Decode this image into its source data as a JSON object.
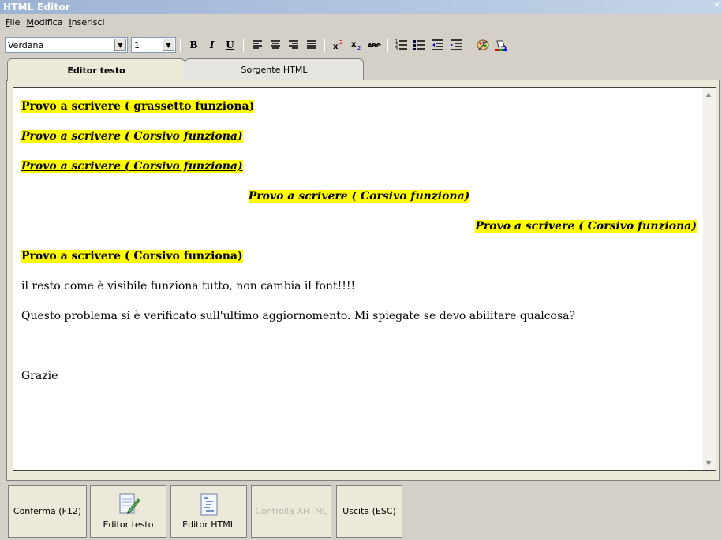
{
  "window": {
    "title": "HTML Editor"
  },
  "menu": {
    "items": [
      {
        "label": "File",
        "key": "F",
        "rest": "ile"
      },
      {
        "label": "Modifica",
        "key": "M",
        "rest": "odifica"
      },
      {
        "label": "Inserisci",
        "key": "I",
        "rest": "nserisci"
      }
    ]
  },
  "toolbar": {
    "font_value": "Verdana",
    "size_value": "1",
    "bold": "B",
    "italic": "I",
    "underline": "U"
  },
  "tabs": [
    {
      "label": "Editor testo",
      "active": true
    },
    {
      "label": "Sorgente HTML",
      "active": false
    }
  ],
  "editor": {
    "paragraphs": [
      {
        "text": "Provo a scrivere ( grassetto funziona)",
        "style": "bold",
        "align": "left",
        "highlight": true
      },
      {
        "text": "Provo a scrivere ( Corsivo funziona)",
        "style": "bold-italic",
        "align": "left",
        "highlight": true
      },
      {
        "text": "Provo a scrivere ( Corsivo funziona)",
        "style": "bold-italic-underline",
        "align": "left",
        "highlight": true
      },
      {
        "text": "Provo a scrivere ( Corsivo funziona)",
        "style": "bold-italic",
        "align": "center",
        "highlight": true
      },
      {
        "text": "Provo a scrivere ( Corsivo funziona)",
        "style": "bold-italic",
        "align": "right",
        "highlight": true
      },
      {
        "text": "Provo a scrivere ( Corsivo funziona)",
        "style": "bold",
        "align": "left",
        "highlight": true
      },
      {
        "text": "il resto come è visibile funziona tutto, non cambia il font!!!!",
        "style": "normal",
        "align": "left",
        "highlight": false
      },
      {
        "text": "Questo problema si è verificato sull'ultimo aggiornomento. Mi spiegate se devo abilitare qualcosa?",
        "style": "normal",
        "align": "left",
        "highlight": false
      },
      {
        "text": "Grazie",
        "style": "normal",
        "align": "left",
        "highlight": false
      }
    ]
  },
  "buttons": {
    "confirm": "Conferma (F12)",
    "editor_text": "Editor testo",
    "editor_html": "Editor HTML",
    "check_xhtml": "Controlla XHTML",
    "exit": "Uscita (ESC)"
  },
  "colors": {
    "highlight": "#ffff00",
    "titlebar": "#9db3d3"
  }
}
